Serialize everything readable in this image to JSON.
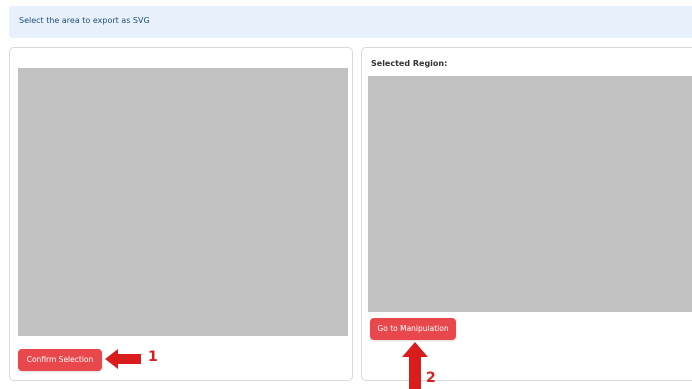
{
  "banner": {
    "text": "Select the area to export as SVG"
  },
  "left_panel": {
    "confirm_label": "Confirm Selection"
  },
  "right_panel": {
    "region_label": "Selected Region:",
    "goto_label": "Go to Manipulation"
  },
  "annotations": {
    "step1": "1",
    "step2": "2"
  },
  "colors": {
    "accent": "#e8484b",
    "annotation": "#d91c1c",
    "canvas": "#c2c2c2",
    "banner_bg": "#e8f1fb"
  },
  "icons": {
    "step1_arrow": "arrow-left-icon",
    "step2_arrow": "arrow-up-icon"
  }
}
